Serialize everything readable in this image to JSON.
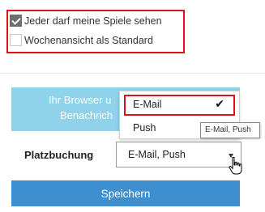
{
  "checkboxes": [
    {
      "label": "Jeder darf meine Spiele sehen",
      "checked": true
    },
    {
      "label": "Wochenansicht als Standard",
      "checked": false
    }
  ],
  "banner": {
    "line1": "Ihr Browser u",
    "line2": "Benachrich"
  },
  "platzbuchung": {
    "label": "Platzbuchung",
    "selected_value": "E-Mail, Push"
  },
  "dropdown": {
    "options": [
      {
        "label": "E-Mail",
        "selected": true,
        "check": "✔"
      },
      {
        "label": "Push",
        "selected": true,
        "check": "✔"
      }
    ]
  },
  "tooltip": {
    "text": "E-Mail, Push"
  },
  "save_button": {
    "label": "Speichern"
  },
  "colors": {
    "highlight_border": "#e01020",
    "banner_bg": "#8fd2ea",
    "button_bg": "#3d8fd0",
    "checkbox_checked": "#6e6e6e"
  },
  "icons": {
    "checkmark": "check-icon",
    "cursor": "hand-pointer-icon",
    "caret": "caret-down-icon"
  }
}
